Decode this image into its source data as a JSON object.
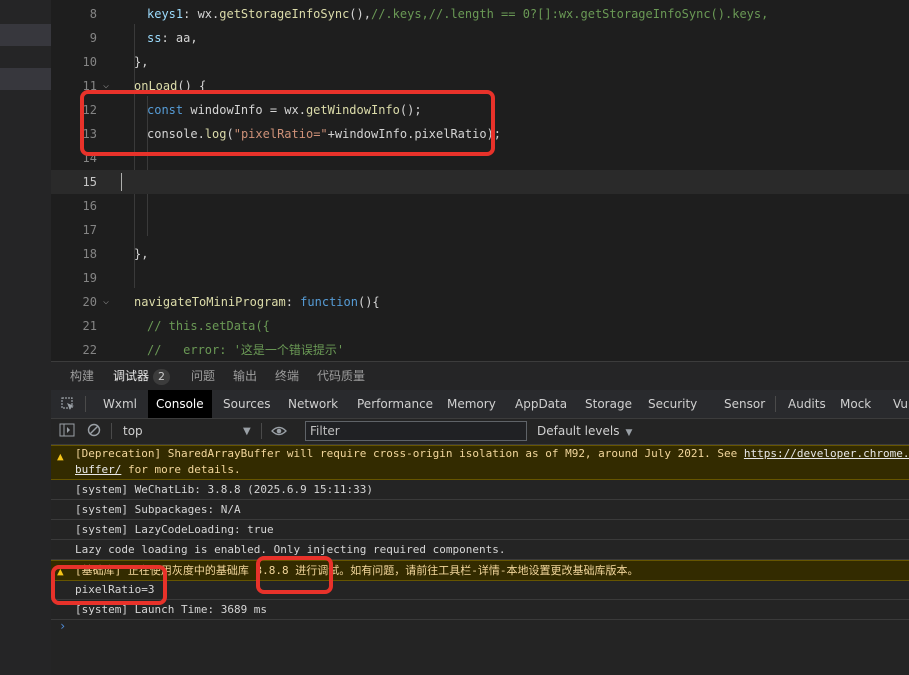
{
  "editor": {
    "lines": [
      {
        "num": "8",
        "parts": [
          [
            "prop",
            "keys1"
          ],
          [
            "plain",
            ": wx."
          ],
          [
            "fn",
            "getStorageInfoSync"
          ],
          [
            "plain",
            "(),"
          ],
          [
            "cm",
            "//.keys,//.length == 0?[]:wx.getStorageInfoSync().keys,"
          ]
        ]
      },
      {
        "num": "9",
        "parts": [
          [
            "prop",
            "ss"
          ],
          [
            "plain",
            ": aa,"
          ]
        ]
      },
      {
        "num": "10",
        "parts": [
          [
            "plain",
            "},"
          ]
        ]
      },
      {
        "num": "11",
        "parts": [
          [
            "fn",
            "onLoad"
          ],
          [
            "plain",
            "() {"
          ]
        ]
      },
      {
        "num": "12",
        "parts": [
          [
            "k",
            "const"
          ],
          [
            "plain",
            " windowInfo = wx."
          ],
          [
            "fn",
            "getWindowInfo"
          ],
          [
            "plain",
            "();"
          ]
        ]
      },
      {
        "num": "13",
        "parts": [
          [
            "plain",
            "console."
          ],
          [
            "fn",
            "log"
          ],
          [
            "plain",
            "("
          ],
          [
            "str",
            "\"pixelRatio=\""
          ],
          [
            "plain",
            "+windowInfo.pixelRatio);"
          ]
        ]
      },
      {
        "num": "14",
        "parts": []
      },
      {
        "num": "15",
        "parts": []
      },
      {
        "num": "16",
        "parts": []
      },
      {
        "num": "17",
        "parts": []
      },
      {
        "num": "18",
        "parts": [
          [
            "plain",
            "},"
          ]
        ]
      },
      {
        "num": "19",
        "parts": []
      },
      {
        "num": "20",
        "parts": [
          [
            "fn",
            "navigateToMiniProgram"
          ],
          [
            "plain",
            ": "
          ],
          [
            "k",
            "function"
          ],
          [
            "plain",
            "(){"
          ]
        ]
      },
      {
        "num": "21",
        "parts": [
          [
            "cm",
            "// this.setData({"
          ]
        ]
      },
      {
        "num": "22",
        "parts": [
          [
            "cm",
            "//   error: '这是一个错误提示'"
          ]
        ]
      }
    ]
  },
  "panel_tabs": [
    {
      "label": "构建"
    },
    {
      "label": "调试器",
      "badge": "2"
    },
    {
      "label": "问题"
    },
    {
      "label": "输出"
    },
    {
      "label": "终端"
    },
    {
      "label": "代码质量"
    }
  ],
  "devtools_tabs": [
    "Wxml",
    "Console",
    "Sources",
    "Network",
    "Performance",
    "Memory",
    "AppData",
    "Storage",
    "Security",
    "Sensor",
    "Audits",
    "Mock",
    "Vul"
  ],
  "console_toolbar": {
    "context": "top",
    "filter_placeholder": "Filter",
    "levels": "Default levels"
  },
  "console": {
    "messages": [
      {
        "type": "warning",
        "line1": "[Deprecation] SharedArrayBuffer will require cross-origin isolation as of M92, around July 2021. See ",
        "link1": "https://developer.chrome.c",
        "link2": "buffer/",
        "line2": " for more details."
      },
      {
        "type": "log",
        "text": "[system] WeChatLib: 3.8.8 (2025.6.9 15:11:33)"
      },
      {
        "type": "log",
        "text": "[system] Subpackages: N/A"
      },
      {
        "type": "log",
        "text": "[system] LazyCodeLoading: true"
      },
      {
        "type": "log",
        "text": "Lazy code loading is enabled. Only injecting required components."
      },
      {
        "type": "warning",
        "text": "[基础库] 正在使用灰度中的基础库 3.8.8 进行调试。如有问题，请前往工具栏-详情-本地设置更改基础库版本。"
      },
      {
        "type": "log",
        "text": "pixelRatio=3"
      },
      {
        "type": "log",
        "text": "[system] Launch Time: 3689 ms"
      }
    ],
    "prompt": "›"
  },
  "colors": {
    "highlight": "#e8322a",
    "accent": "#569cd6"
  }
}
